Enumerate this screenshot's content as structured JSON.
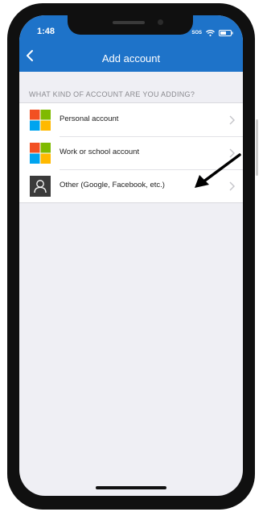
{
  "status_bar": {
    "time": "1:48",
    "sos": "SOS"
  },
  "nav": {
    "title": "Add account"
  },
  "section": {
    "header": "WHAT KIND OF ACCOUNT ARE YOU ADDING?"
  },
  "accounts": [
    {
      "label": "Personal account",
      "icon": "microsoft-logo-icon"
    },
    {
      "label": "Work or school account",
      "icon": "microsoft-logo-icon"
    },
    {
      "label": "Other (Google, Facebook, etc.)",
      "icon": "generic-person-icon"
    }
  ],
  "colors": {
    "brand_blue": "#1e73c9",
    "ms_red": "#f25022",
    "ms_green": "#7fba00",
    "ms_blue": "#00a4ef",
    "ms_yellow": "#ffb900"
  }
}
